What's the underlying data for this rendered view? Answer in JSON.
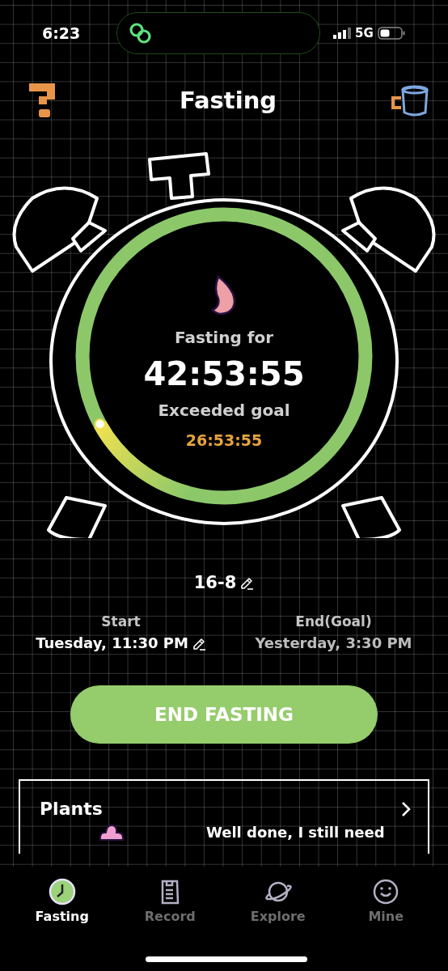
{
  "status_bar": {
    "time": "6:23",
    "network": "5G"
  },
  "header": {
    "title": "Fasting"
  },
  "timer": {
    "label": "Fasting for",
    "elapsed": "42:53:55",
    "status": "Exceeded goal",
    "extra": "26:53:55"
  },
  "plan": {
    "name": "16-8"
  },
  "times": [
    {
      "label": "Start",
      "value": "Tuesday, 11:30 PM",
      "editable": true
    },
    {
      "label": "End(Goal)",
      "value": "Yesterday, 3:30 PM",
      "editable": false
    }
  ],
  "end_button": "END FASTING",
  "plants": {
    "title": "Plants",
    "message": "Well done, I still need"
  },
  "tabs": [
    {
      "label": "Fasting",
      "selected": true
    },
    {
      "label": "Record",
      "selected": false
    },
    {
      "label": "Explore",
      "selected": false
    },
    {
      "label": "Mine",
      "selected": false
    }
  ]
}
